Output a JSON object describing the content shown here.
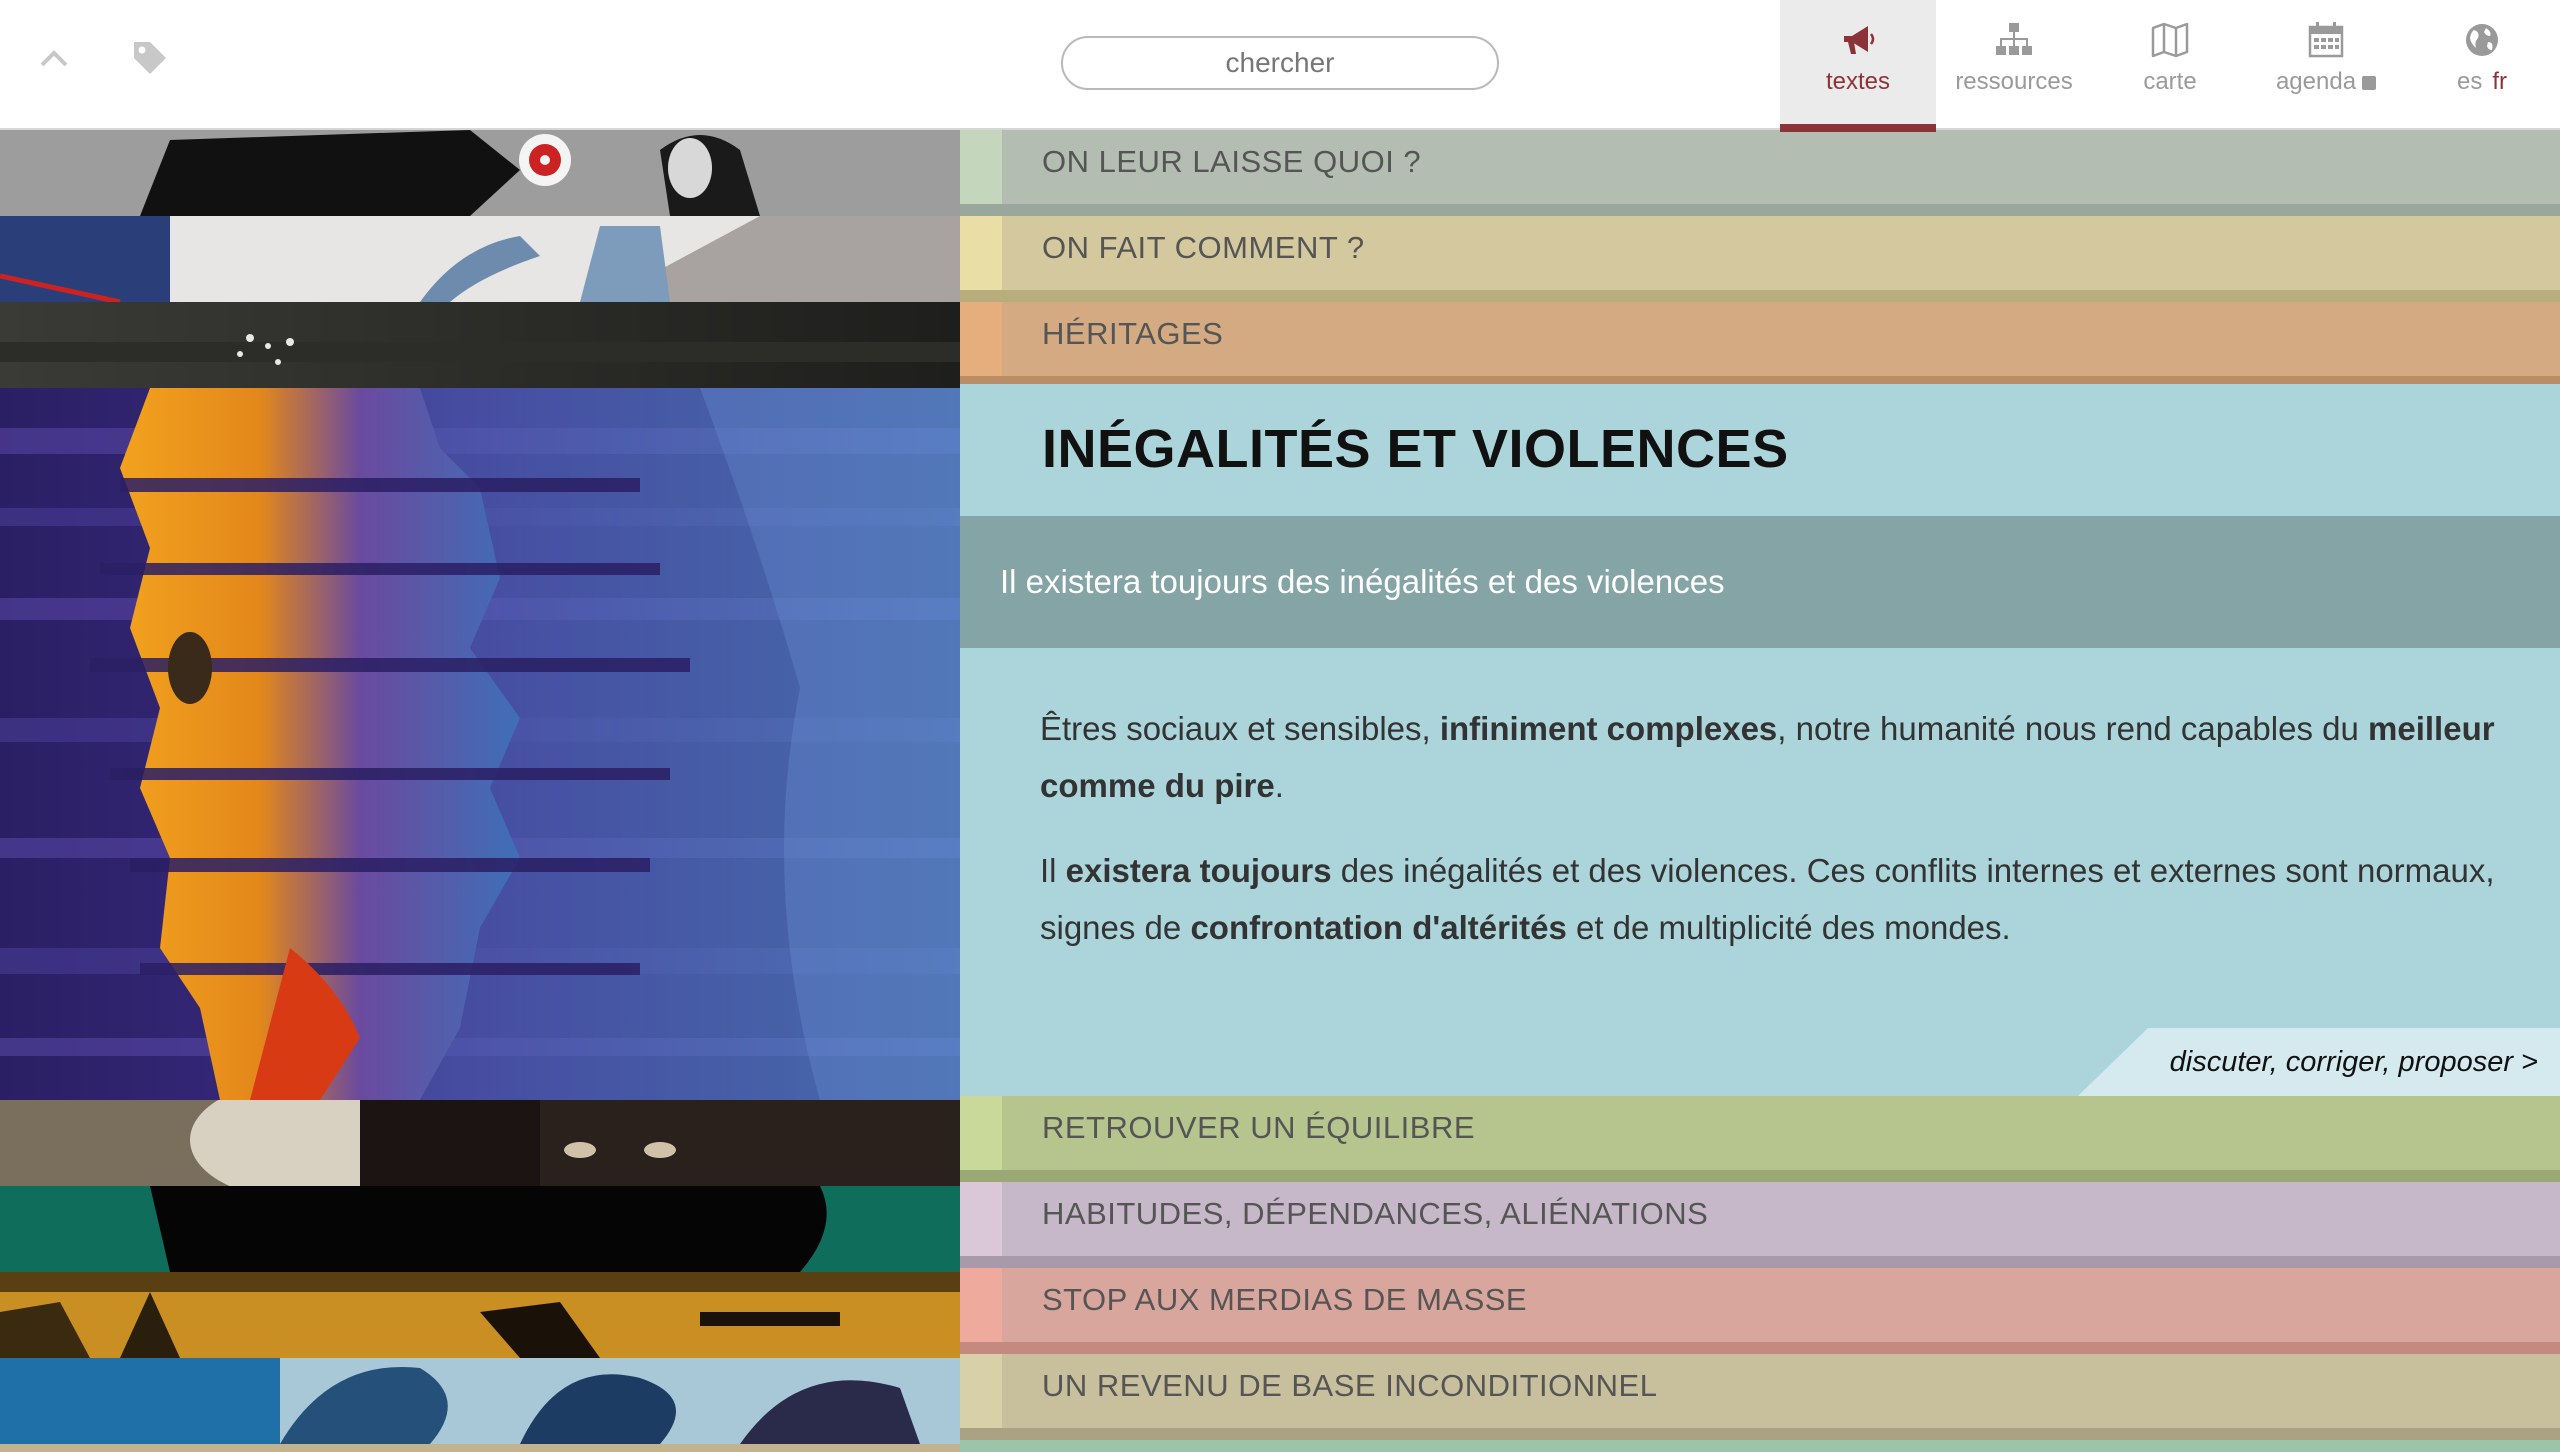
{
  "header": {
    "search_placeholder": "chercher",
    "nav": [
      {
        "label": "textes",
        "icon": "megaphone-icon",
        "active": true
      },
      {
        "label": "ressources",
        "icon": "sitemap-icon",
        "active": false
      },
      {
        "label": "carte",
        "icon": "map-icon",
        "active": false
      },
      {
        "label": "agenda",
        "icon": "calendar-icon",
        "active": false
      }
    ],
    "lang_other": "es",
    "lang_current": "fr"
  },
  "sections_top": [
    {
      "title": "ON LEUR LAISSE QUOI ?"
    },
    {
      "title": "ON FAIT COMMENT ?"
    },
    {
      "title": "HÉRITAGES"
    }
  ],
  "open_section": {
    "title": "INÉGALITÉS ET VIOLENCES",
    "subtitle": "Il existera toujours des inégalités et des violences",
    "p1": {
      "t1": "Êtres sociaux et sensibles, ",
      "b1": "infiniment complexes",
      "t2": ", notre humanité nous rend capables du ",
      "b2": "meilleur comme du pire",
      "t3": "."
    },
    "p2": {
      "t1": "Il ",
      "b1": "existera toujours",
      "t2": " des inégalités et des violences. Ces conflits internes et externes sont normaux, signes de ",
      "b2": "confrontation d'altérités",
      "t3": " et de multiplicité des mondes."
    },
    "discuss_link": "discuter, corriger, proposer >"
  },
  "sections_bottom": [
    {
      "title": "RETROUVER UN ÉQUILIBRE"
    },
    {
      "title": "HABITUDES, DÉPENDANCES, ALIÉNATIONS"
    },
    {
      "title": "STOP AUX MERDIAS DE MASSE"
    },
    {
      "title": "UN REVENU DE BASE INCONDITIONNEL"
    }
  ],
  "colors": {
    "accent": "#8c3338",
    "open_bg": "#abd5da",
    "open_sub_bg": "#85a4a6"
  }
}
